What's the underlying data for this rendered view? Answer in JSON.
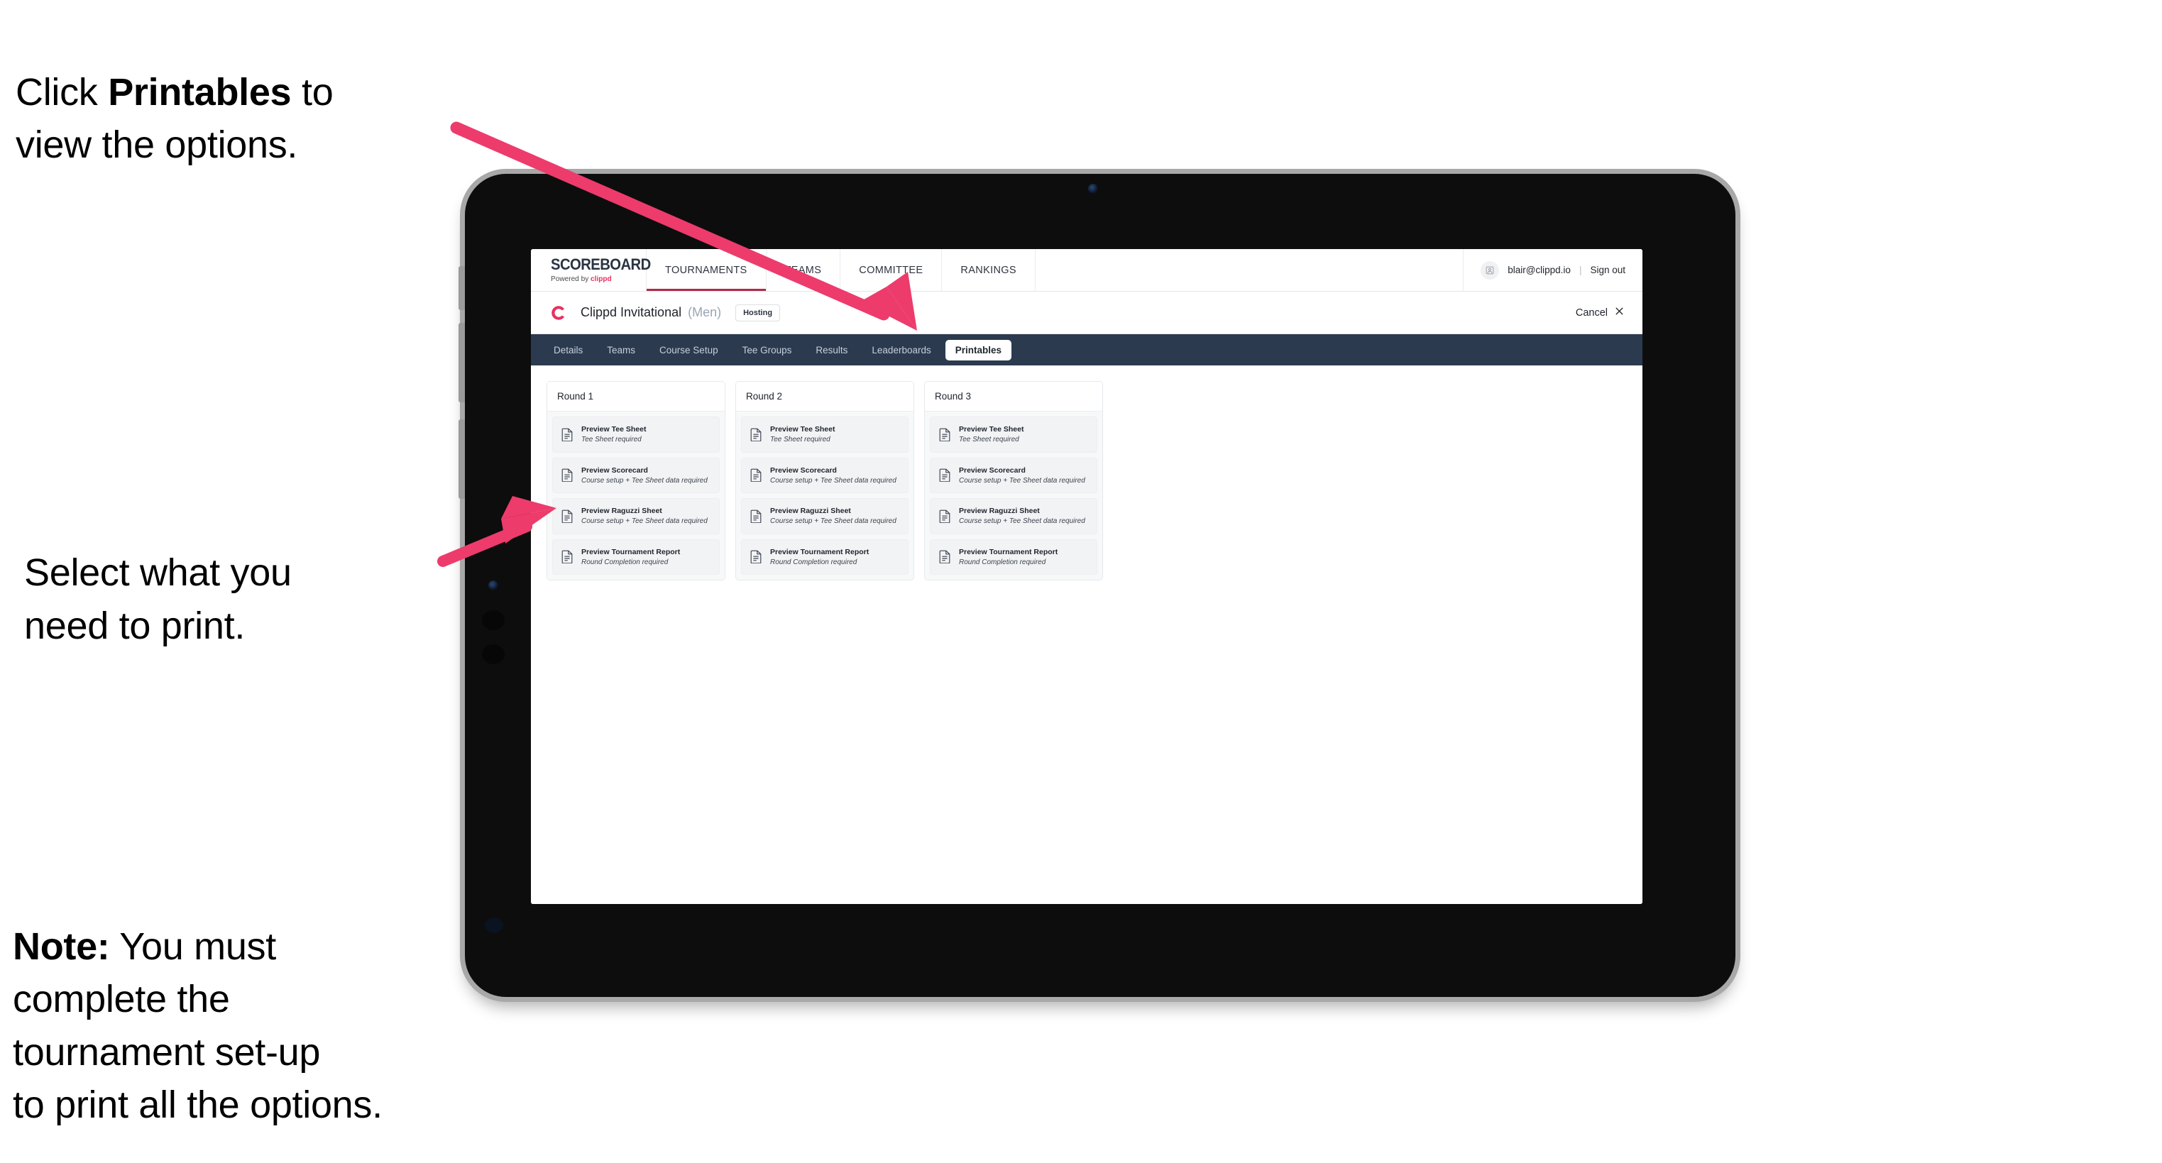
{
  "annotations": {
    "callout_1_pre": "Click ",
    "callout_1_bold": "Printables",
    "callout_1_post": " to\nview the options.",
    "callout_2": "Select what you\n need to print.",
    "callout_3_bold": "Note:",
    "callout_3_post": " You must\ncomplete the\ntournament set-up\nto print all the options.",
    "arrow_color": "#ed3b6c"
  },
  "app": {
    "brand": {
      "name": "SCOREBOARD",
      "powered_prefix": "Powered by ",
      "powered_brand": "clippd"
    },
    "nav_tabs": [
      {
        "label": "TOURNAMENTS",
        "active": true
      },
      {
        "label": "TEAMS",
        "active": false
      },
      {
        "label": "COMMITTEE",
        "active": false
      },
      {
        "label": "RANKINGS",
        "active": false
      }
    ],
    "account": {
      "avatar_icon": "user-avatar-icon",
      "email": "blair@clippd.io",
      "separator": "|",
      "sign_out": "Sign out"
    }
  },
  "tournament": {
    "logo_icon": "clippd-c-logo-icon",
    "title": "Clippd Invitational",
    "gender": "(Men)",
    "status_badge": "Hosting",
    "cancel_label": "Cancel",
    "cancel_icon": "close-x-icon"
  },
  "section_nav": {
    "items": [
      {
        "label": "Details",
        "active": false
      },
      {
        "label": "Teams",
        "active": false
      },
      {
        "label": "Course Setup",
        "active": false
      },
      {
        "label": "Tee Groups",
        "active": false
      },
      {
        "label": "Results",
        "active": false
      },
      {
        "label": "Leaderboards",
        "active": false
      },
      {
        "label": "Printables",
        "active": true
      }
    ]
  },
  "printables": {
    "rounds": [
      {
        "header": "Round 1",
        "items": [
          {
            "title": "Preview Tee Sheet",
            "requirement": "Tee Sheet required",
            "icon": "document-icon"
          },
          {
            "title": "Preview Scorecard",
            "requirement": "Course setup + Tee Sheet data required",
            "icon": "document-icon"
          },
          {
            "title": "Preview Raguzzi Sheet",
            "requirement": "Course setup + Tee Sheet data required",
            "icon": "document-icon"
          },
          {
            "title": "Preview Tournament Report",
            "requirement": "Round Completion required",
            "icon": "document-icon"
          }
        ]
      },
      {
        "header": "Round 2",
        "items": [
          {
            "title": "Preview Tee Sheet",
            "requirement": "Tee Sheet required",
            "icon": "document-icon"
          },
          {
            "title": "Preview Scorecard",
            "requirement": "Course setup + Tee Sheet data required",
            "icon": "document-icon"
          },
          {
            "title": "Preview Raguzzi Sheet",
            "requirement": "Course setup + Tee Sheet data required",
            "icon": "document-icon"
          },
          {
            "title": "Preview Tournament Report",
            "requirement": "Round Completion required",
            "icon": "document-icon"
          }
        ]
      },
      {
        "header": "Round 3",
        "items": [
          {
            "title": "Preview Tee Sheet",
            "requirement": "Tee Sheet required",
            "icon": "document-icon"
          },
          {
            "title": "Preview Scorecard",
            "requirement": "Course setup + Tee Sheet data required",
            "icon": "document-icon"
          },
          {
            "title": "Preview Raguzzi Sheet",
            "requirement": "Course setup + Tee Sheet data required",
            "icon": "document-icon"
          },
          {
            "title": "Preview Tournament Report",
            "requirement": "Round Completion required",
            "icon": "document-icon"
          }
        ]
      }
    ]
  },
  "colors": {
    "accent_pink": "#e8305e",
    "nav_dark": "#2b3a4f",
    "tab_underline": "#b02a4a",
    "arrow": "#ed3b6c"
  }
}
